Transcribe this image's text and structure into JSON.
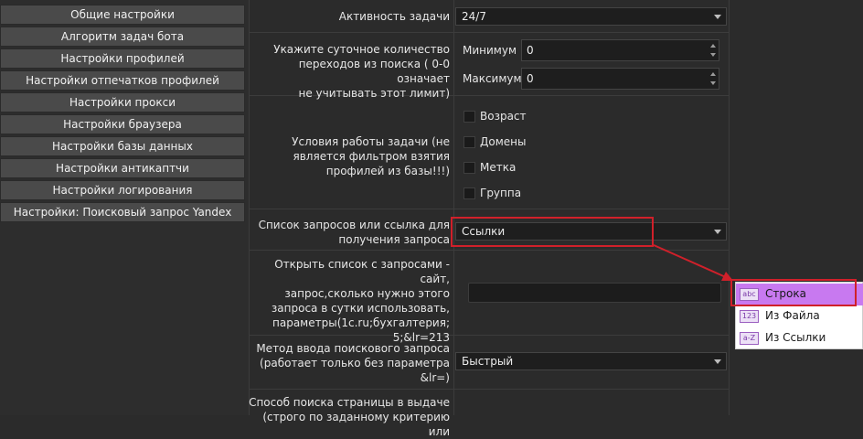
{
  "sidebar": {
    "items": [
      "Общие настройки",
      "Алгоритм задач бота",
      "Настройки профилей",
      "Настройки отпечатков профилей",
      "Настройки прокси",
      "Настройки браузера",
      "Настройки базы данных",
      "Настройки антикаптчи",
      "Настройки логирования",
      "Настройки: Поисковый запрос Yandex"
    ]
  },
  "form": {
    "activity": {
      "label": "Активность задачи",
      "value": "24/7"
    },
    "daily_count": {
      "label": "Укажите суточное количество\nпереходов из поиска ( 0-0 означает\nне учитывать этот лимит)",
      "min_label": "Минимум",
      "min_value": "0",
      "max_label": "Максимум",
      "max_value": "0"
    },
    "conditions": {
      "label": "Условия работы задачи (не\nявляется фильтром взятия\nпрофилей из базы!!!)",
      "options": [
        "Возраст",
        "Домены",
        "Метка",
        "Группа"
      ]
    },
    "query_list": {
      "label": "Список запросов или ссылка для\nполучения запроса",
      "value": "Ссылки"
    },
    "open_list": {
      "label": "Открыть список с запросами - сайт,\nзапрос,сколько нужно этого\nзапроса в сутки использовать,\nпараметры(1c.ru;бухгалтерия;\n5;&lr=213",
      "value": ""
    },
    "input_method": {
      "label": "Метод ввода поискового запроса\n(работает только без параметра\n&lr=)",
      "value": "Быстрый"
    },
    "search_method": {
      "label": "Способ поиска страницы в выдаче\n(строго по заданному критерию или"
    }
  },
  "menu": {
    "items": [
      {
        "badge": "abc",
        "label": "Строка",
        "selected": true
      },
      {
        "badge": "123",
        "label": "Из Файла",
        "selected": false
      },
      {
        "badge": "a-Z",
        "label": "Из Ссылки",
        "selected": false
      }
    ]
  },
  "colors": {
    "highlight_red": "#d0202a",
    "menu_selected": "#c879f0"
  }
}
